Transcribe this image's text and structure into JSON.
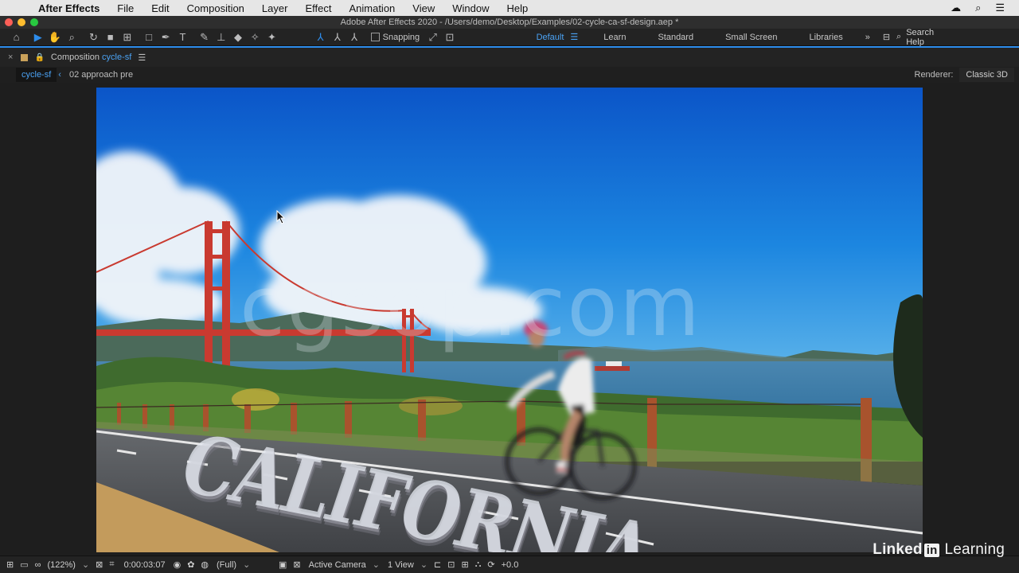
{
  "menubar": {
    "app": "After Effects",
    "items": [
      "File",
      "Edit",
      "Composition",
      "Layer",
      "Effect",
      "Animation",
      "View",
      "Window",
      "Help"
    ]
  },
  "window": {
    "title": "Adobe After Effects 2020 - /Users/demo/Desktop/Examples/02-cycle-ca-sf-design.aep *"
  },
  "toolbar": {
    "snapping_label": "Snapping",
    "workspaces": [
      "Default",
      "Learn",
      "Standard",
      "Small Screen",
      "Libraries"
    ],
    "search_label": "Search Help"
  },
  "panel": {
    "label": "Composition",
    "composition_name": "cycle-sf",
    "breadcrumbs": [
      "cycle-sf",
      "02 approach pre"
    ],
    "renderer_label": "Renderer:",
    "renderer_value": "Classic 3D"
  },
  "viewer": {
    "title_text": "CALIFORNIA",
    "watermark": "cgsop.com"
  },
  "bottombar": {
    "zoom": "(122%)",
    "timecode": "0:00:03:07",
    "resolution": "(Full)",
    "camera": "Active Camera",
    "views": "1 View",
    "exposure": "+0.0"
  },
  "branding": {
    "linked": "Linked",
    "in": "in",
    "learning": "Learning"
  },
  "colors": {
    "accent": "#2d8ceb",
    "bridge": "#c93a30",
    "sky": "#1a78d6"
  }
}
